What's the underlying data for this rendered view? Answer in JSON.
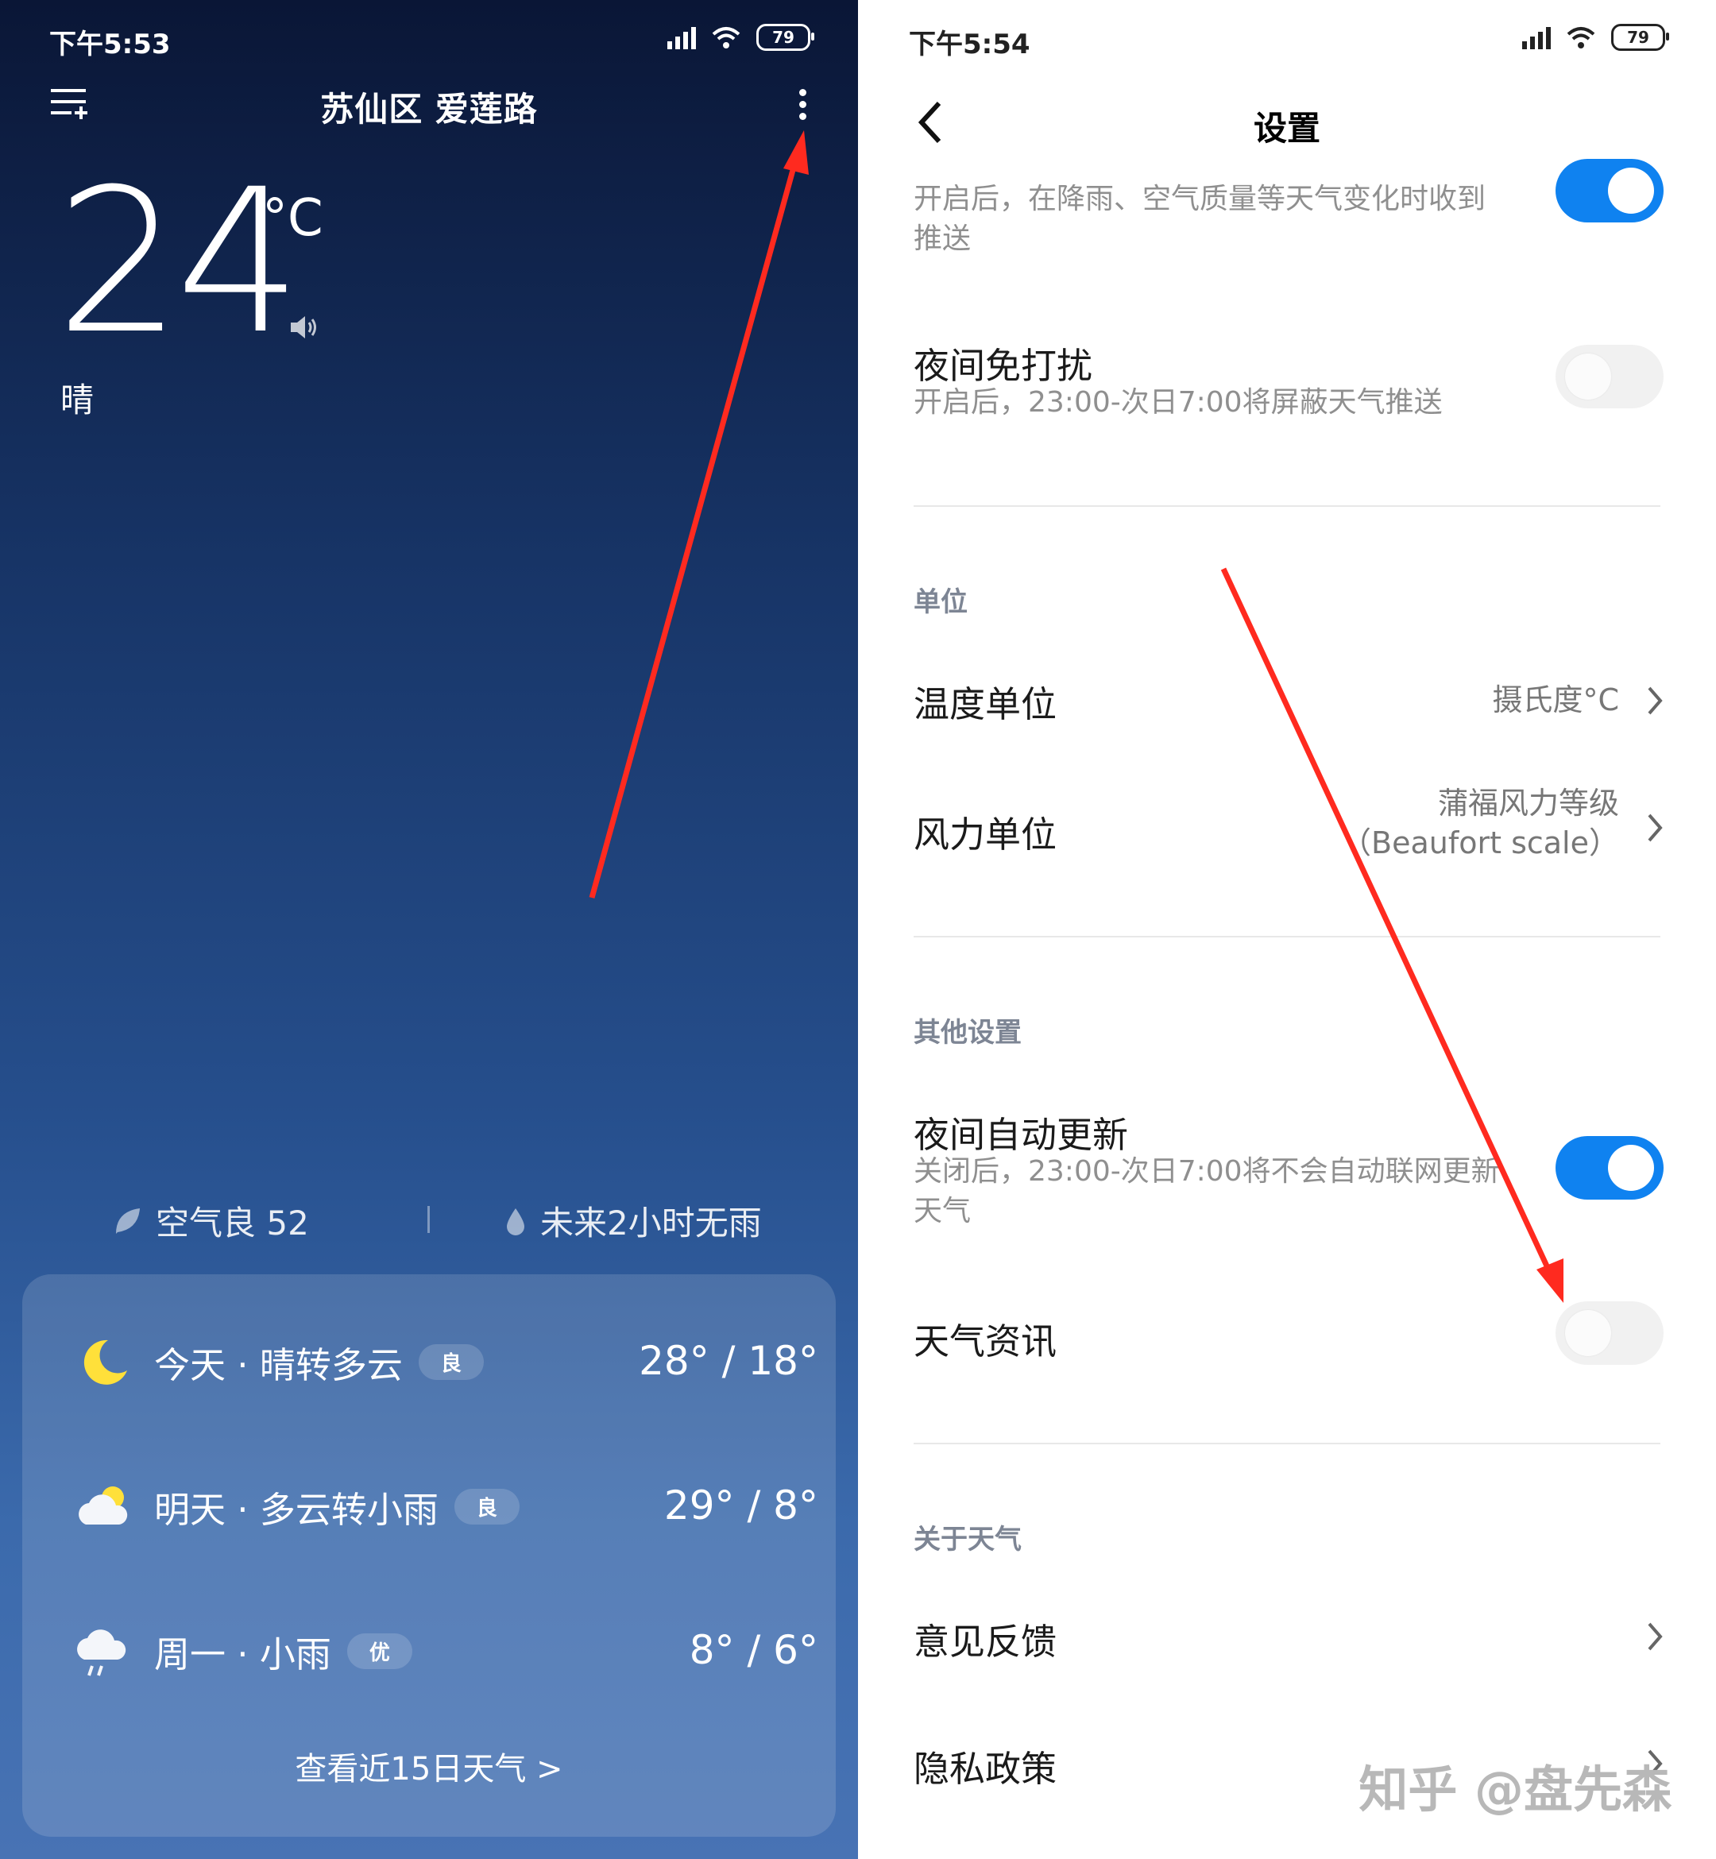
{
  "left": {
    "status_time": "下午5:53",
    "battery": "79",
    "location_title": "苏仙区 爱莲路",
    "temperature": "24",
    "temp_unit": "°C",
    "condition": "晴",
    "air_quality": "空气良 52",
    "rain_forecast": "未来2小时无雨",
    "forecast": [
      {
        "day": "今天 · 晴转多云",
        "aqi": "良",
        "temps": "28° / 18°",
        "icon": "moon-icon"
      },
      {
        "day": "明天 · 多云转小雨",
        "aqi": "良",
        "temps": "29° / 8°",
        "icon": "partly-cloudy-icon"
      },
      {
        "day": "周一 · 小雨",
        "aqi": "优",
        "temps": "8° / 6°",
        "icon": "light-rain-icon"
      }
    ],
    "more_link": "查看近15日天气  >"
  },
  "right": {
    "status_time": "下午5:54",
    "battery": "79",
    "title": "设置",
    "push_desc": "开启后，在降雨、空气质量等天气变化时收到推送",
    "dnd_label": "夜间免打扰",
    "dnd_desc": "开启后，23:00-次日7:00将屏蔽天气推送",
    "section_units": "单位",
    "temp_unit_label": "温度单位",
    "temp_unit_value": "摄氏度°C",
    "wind_unit_label": "风力单位",
    "wind_unit_value_1": "蒲福风力等级",
    "wind_unit_value_2": "（Beaufort scale）",
    "section_other": "其他设置",
    "night_update_label": "夜间自动更新",
    "night_update_desc": "关闭后，23:00-次日7:00将不会自动联网更新天气",
    "weather_news_label": "天气资讯",
    "section_about": "关于天气",
    "feedback_label": "意见反馈",
    "privacy_label": "隐私政策",
    "toggles": {
      "push": true,
      "dnd": false,
      "night_update": true,
      "weather_news": false
    }
  },
  "watermark": "知乎 @盘先森",
  "colors": {
    "accent": "#0f82f0",
    "arrow": "#ff2a1f"
  }
}
